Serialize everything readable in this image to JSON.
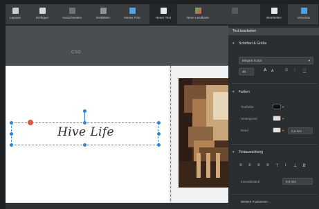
{
  "toolbar": {
    "items": [
      {
        "label": "Layouts",
        "icon": "layouts-icon"
      },
      {
        "label": "Einfügen",
        "icon": "insert-icon"
      },
      {
        "label": "Ausschneiden",
        "icon": "cut-icon"
      },
      {
        "label": "Einkleben",
        "icon": "paste-icon"
      },
      {
        "label": "Neues Foto",
        "icon": "new-photo-icon"
      },
      {
        "label": "Neuer Text",
        "icon": "new-text-icon"
      },
      {
        "label": "Neue Landkarte",
        "icon": "new-map-icon"
      },
      {
        "label": "",
        "icon": "blank-icon"
      },
      {
        "label": "Bearbeiten",
        "icon": "edit-icon"
      },
      {
        "label": "Vorschau",
        "icon": "preview-icon"
      }
    ]
  },
  "canvas": {
    "label": "CSD",
    "text_content": "Hive Life"
  },
  "panel": {
    "title": "Text bearbeiten",
    "sections": {
      "font": {
        "title": "Schriftart & Größe",
        "font_name": "Elegant Script",
        "size": "46"
      },
      "colors": {
        "title": "Farben",
        "text_color_label": "Textfarbe",
        "background_label": "Hintergrund",
        "border_label": "Rand",
        "border_width": "0,5 mm"
      },
      "alignment": {
        "title": "Textausrichtung",
        "padding_label": "Innenabstand",
        "padding_value": "0,5 mm"
      },
      "more_label": "Weitere Funktionen …"
    }
  },
  "colors": {
    "accent": "#2b84d6",
    "handle_red": "#e2574a",
    "panel_bg": "#2b2e31"
  }
}
